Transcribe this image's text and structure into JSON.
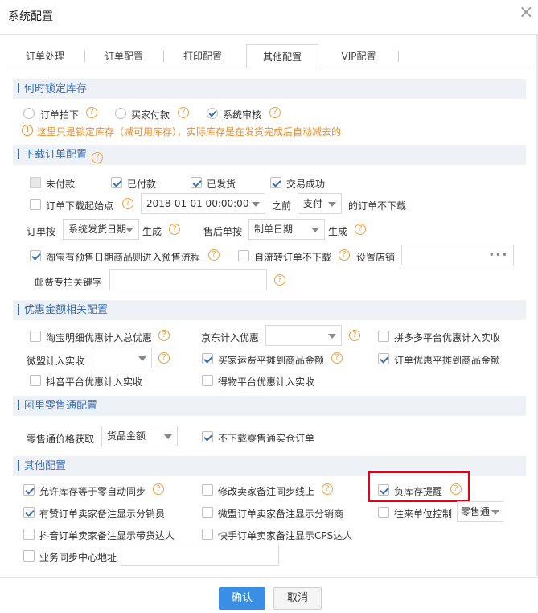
{
  "dialog": {
    "title": "系统配置",
    "close_glyph": "×"
  },
  "tabs": [
    "订单处理",
    "订单配置",
    "打印配置",
    "其他配置",
    "VIP配置"
  ],
  "help_glyph": "?",
  "warn_glyph": "!",
  "lock_stock": {
    "title": "何时锁定库存",
    "options": [
      "订单拍下",
      "买家付款",
      "系统审核"
    ],
    "notice": "这里只是锁定库存（减可用库存），实际库存是在发货完成后自动减去的"
  },
  "download": {
    "title": "下载订单配置",
    "status": [
      "未付款",
      "已付款",
      "已发货",
      "交易成功"
    ],
    "start_label": "订单下载起始点",
    "start_value": "2018-01-01 00:00:00",
    "before": "之前",
    "pay_value": "支付",
    "not_download": "的订单不下载",
    "order_by": "订单按",
    "order_by_value": "系统发货日期",
    "generate": "生成",
    "after_sale_by": "售后单按",
    "after_sale_value": "制单日期",
    "generate2": "生成",
    "presale": "淘宝有预售日期商品则进入预售流程",
    "self_flow": "自流转订单不下载",
    "set_shop": "设置店铺",
    "more": "•••",
    "postage_label": "邮费专拍关键字"
  },
  "discount": {
    "title": "优惠金额相关配置",
    "taobao": "淘宝明细优惠计入总优惠",
    "jd": "京东计入优惠",
    "pdd": "拼多多平台优惠计入实收",
    "weimeng": "微盟计入实收",
    "buyer_freight": "买家运费平摊到商品金额",
    "order_discount": "订单优惠平摊到商品金额",
    "douyin": "抖音平台优惠计入实收",
    "dewu": "得物平台优惠计入实收"
  },
  "ali": {
    "title": "阿里零售通配置",
    "price_label": "零售通价格获取",
    "price_value": "货品金额",
    "no_download": "不下载零售通实仓订单"
  },
  "other": {
    "title": "其他配置",
    "allow_zero": "允许库存等于零自动同步",
    "modify_remark": "修改卖家备注同步线上",
    "negative_stock": "负库存提醒",
    "youzan": "有赞订单卖家备注显示分销员",
    "weimeng_remark": "微盟订单卖家备注显示分销商",
    "unit_control": "往来单位控制",
    "unit_value": "零售通",
    "douyin_remark": "抖音订单卖家备注显示带货达人",
    "kuaishou_remark": "快手订单卖家备注显示CPS达人",
    "sync_center": "业务同步中心地址"
  },
  "footer": {
    "ok": "确认",
    "cancel": "取消"
  }
}
